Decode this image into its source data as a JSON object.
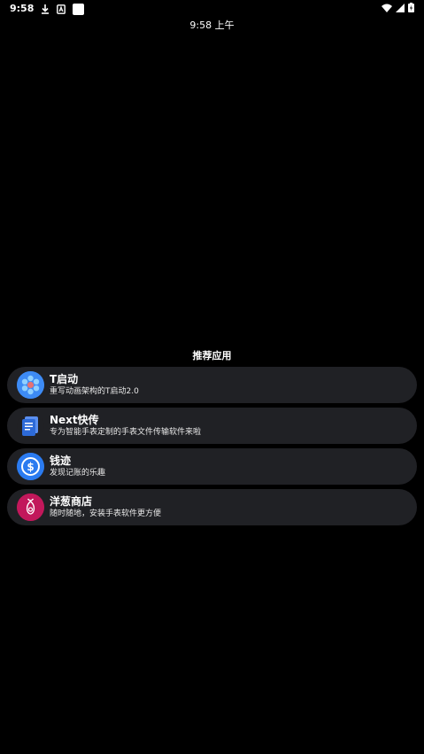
{
  "status_bar": {
    "time": "9:58"
  },
  "clock": {
    "text": "9:58 上午"
  },
  "section": {
    "title": "推荐应用"
  },
  "apps": [
    {
      "name": "T启动",
      "description": "重写动画架构的T启动2.0",
      "icon": "flower-launcher-icon",
      "icon_color": "#3d8bf5"
    },
    {
      "name": "Next快传",
      "description": "专为智能手表定制的手表文件传输软件来啦",
      "icon": "file-transfer-icon",
      "icon_color": "#2d6ad8"
    },
    {
      "name": "钱迹",
      "description": "发现记账的乐趣",
      "icon": "dollar-icon",
      "icon_color": "#2b7bf0"
    },
    {
      "name": "洋葱商店",
      "description": "随时随地，安装手表软件更方便",
      "icon": "onion-store-icon",
      "icon_color": "#c2185b"
    }
  ],
  "colors": {
    "background": "#000000",
    "card": "#202125",
    "text": "#ffffff"
  }
}
